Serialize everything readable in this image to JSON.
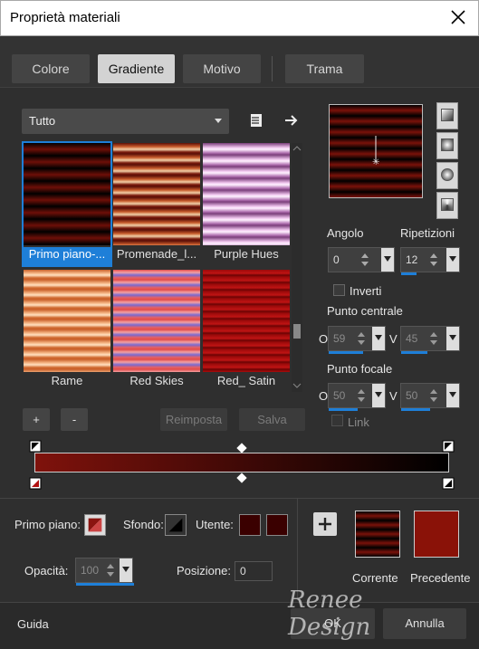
{
  "window": {
    "title": "Proprietà materiali"
  },
  "tabs": [
    {
      "label": "Colore"
    },
    {
      "label": "Gradiente"
    },
    {
      "label": "Motivo"
    },
    {
      "label": "Trama"
    }
  ],
  "category": {
    "value": "Tutto"
  },
  "gallery": [
    {
      "label": "Primo piano-...",
      "selected": true
    },
    {
      "label": "Promenade_l..."
    },
    {
      "label": "Purple Hues"
    },
    {
      "label": "Rame"
    },
    {
      "label": "Red Skies"
    },
    {
      "label": "Red_ Satin"
    }
  ],
  "gallery_buttons": {
    "add": "+",
    "remove": "-",
    "reset": "Reimposta",
    "save": "Salva"
  },
  "angle": {
    "label": "Angolo",
    "value": "0"
  },
  "repeats": {
    "label": "Ripetizioni",
    "value": "12",
    "level": 0.12
  },
  "invert": {
    "label": "Inverti"
  },
  "center": {
    "label": "Punto centrale",
    "h_label": "O",
    "h_value": "59",
    "v_label": "V",
    "v_value": "45"
  },
  "focal": {
    "label": "Punto focale",
    "h_label": "O",
    "h_value": "50",
    "v_label": "V",
    "v_value": "50"
  },
  "link": {
    "label": "Link"
  },
  "foreground": {
    "label": "Primo piano:"
  },
  "background": {
    "label": "Sfondo:"
  },
  "user": {
    "label": "Utente:"
  },
  "opacity": {
    "label": "Opacità:",
    "value": "100"
  },
  "position": {
    "label": "Posizione:",
    "value": "0"
  },
  "current": {
    "label": "Corrente"
  },
  "previous": {
    "label": "Precedente"
  },
  "footer": {
    "help": "Guida",
    "ok": "OK",
    "cancel": "Annulla"
  },
  "watermark": "Renee Design",
  "colors": {
    "gradient_start": "#7f120c",
    "gradient_end": "#000000",
    "user_color": "#3a0000",
    "previous_color": "#8a1208",
    "accent": "#1e7fd8"
  }
}
